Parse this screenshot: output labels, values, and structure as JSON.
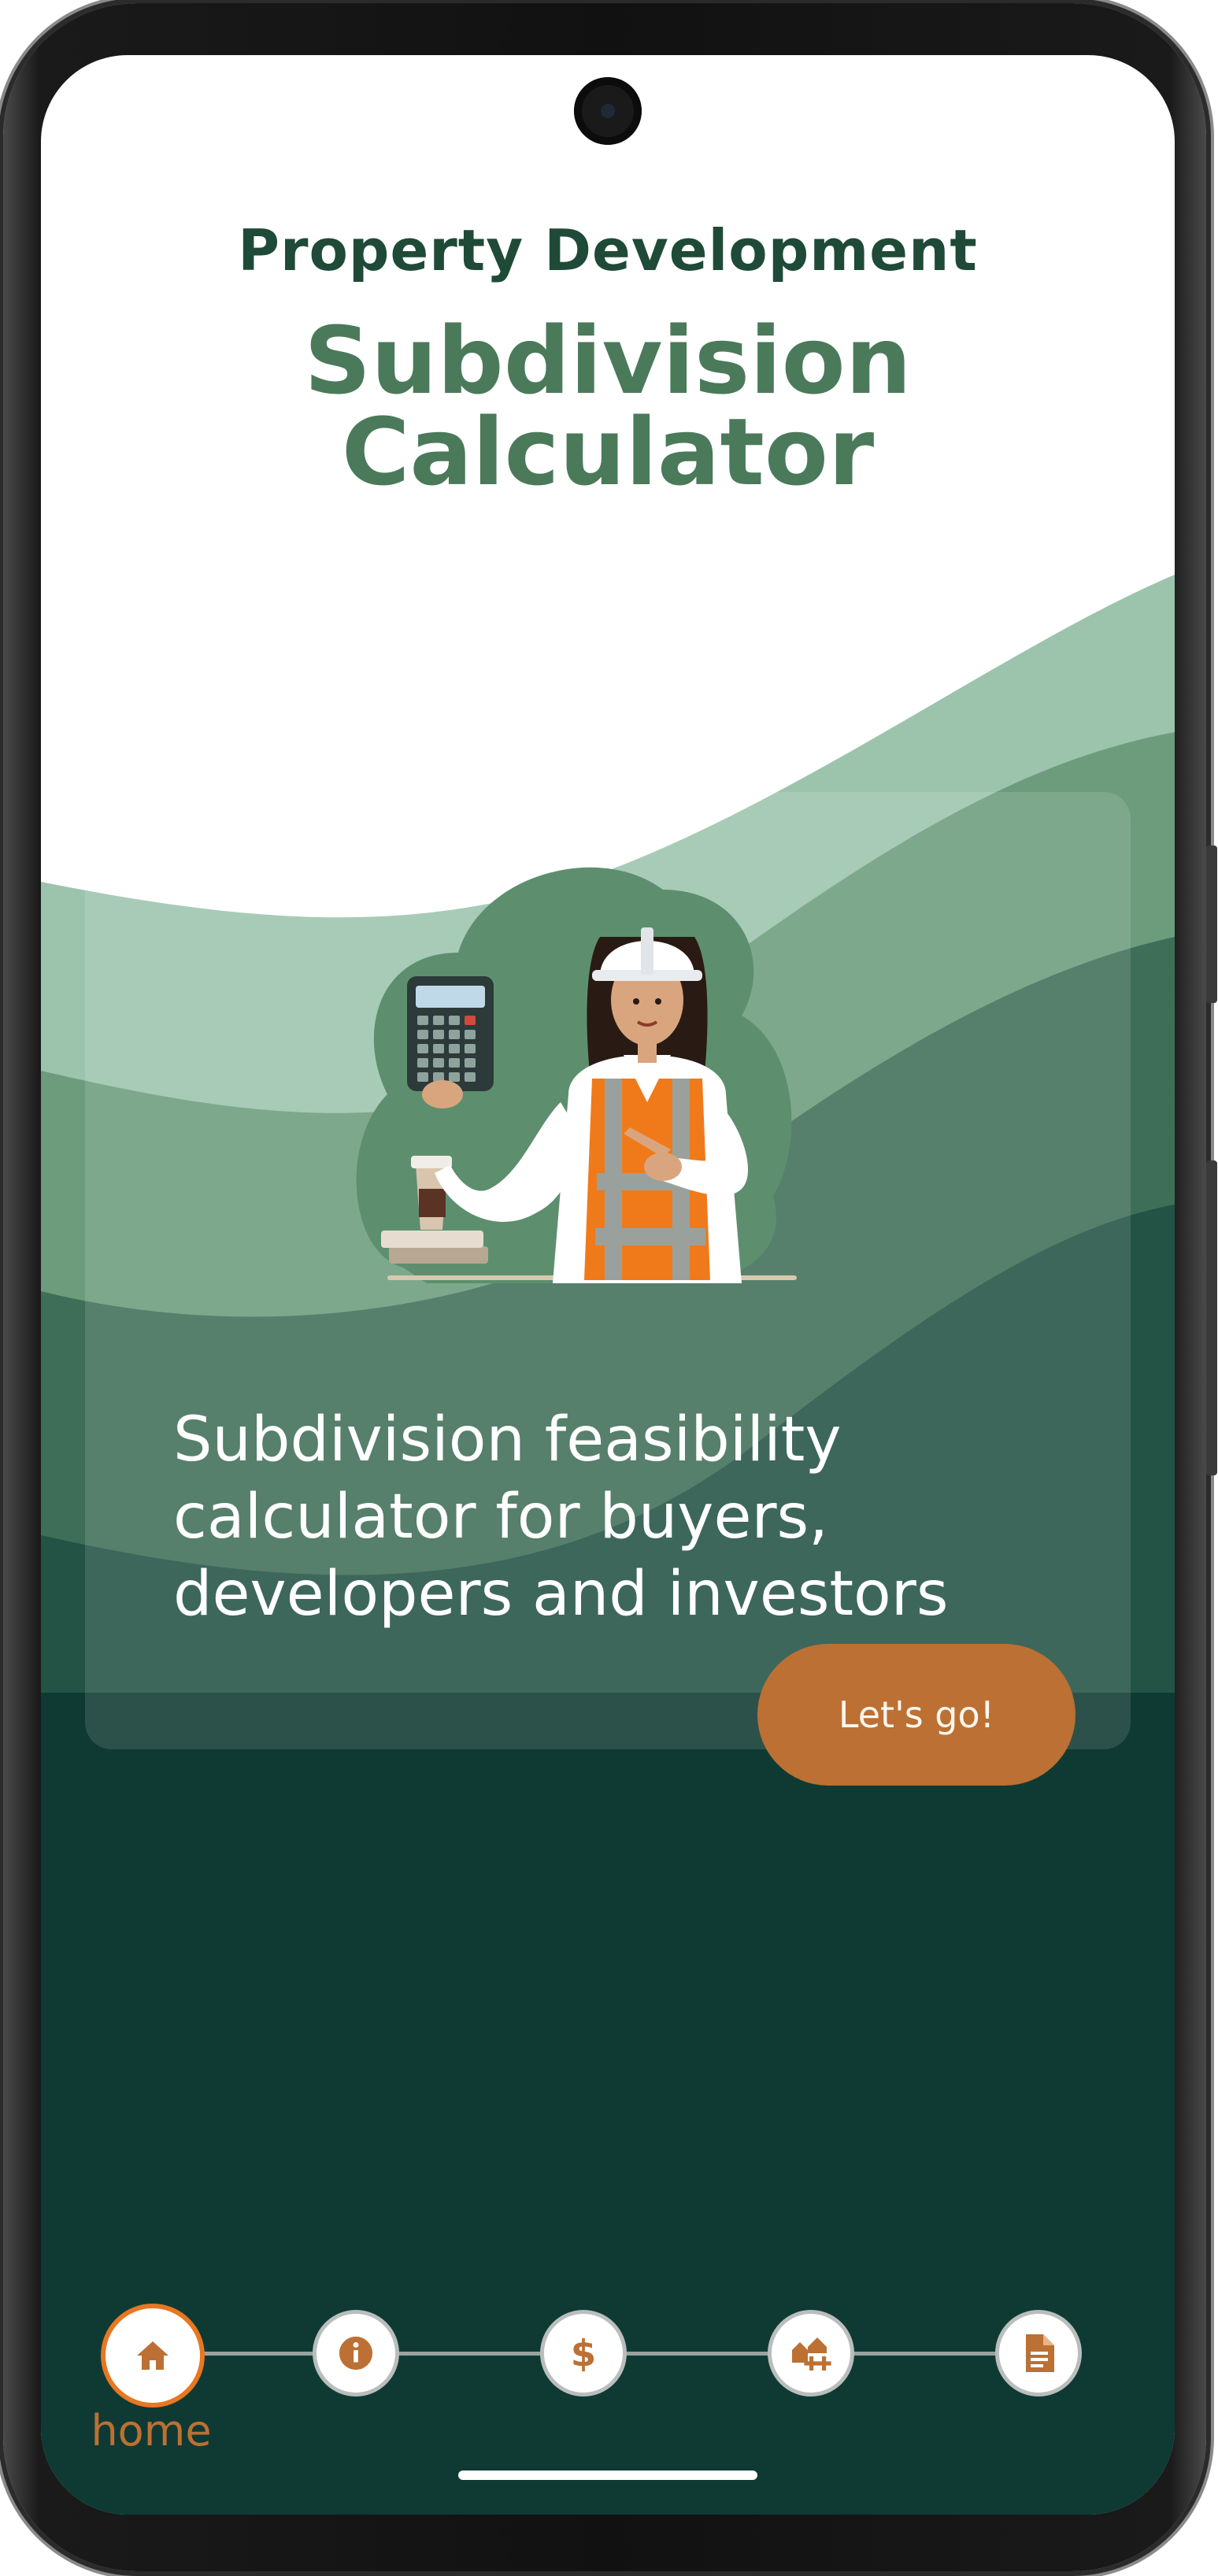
{
  "header": {
    "subtitle": "Property Development",
    "title_line1": "Subdivision",
    "title_line2": "Calculator"
  },
  "hero": {
    "tagline_line1": "Subdivision feasibility",
    "tagline_line2": "calculator for buyers,",
    "tagline_line3": "developers and investors"
  },
  "cta": {
    "label": "Let's go!"
  },
  "stepper": {
    "steps": [
      {
        "icon": "home-icon",
        "label": "home",
        "active": true
      },
      {
        "icon": "info-icon",
        "active": false
      },
      {
        "icon": "dollar-icon",
        "active": false
      },
      {
        "icon": "houses-plus-icon",
        "active": false
      },
      {
        "icon": "document-icon",
        "active": false
      }
    ]
  },
  "colors": {
    "title_dark": "#1f4a37",
    "title_green": "#4a7a5a",
    "background_dark": "#0f3a33",
    "accent_orange": "#bc7033",
    "active_ring": "#e87722"
  }
}
